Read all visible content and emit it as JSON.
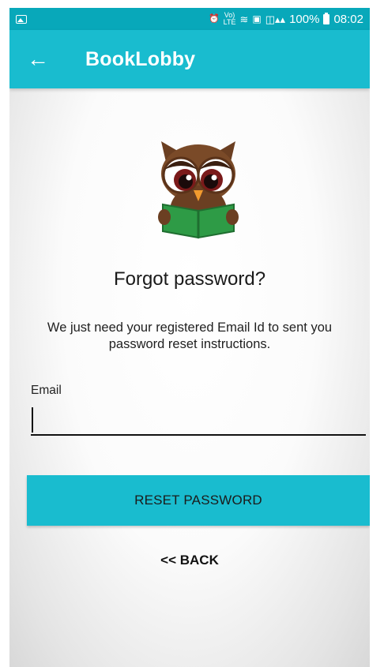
{
  "status_bar": {
    "volte_label": "Vo)\nLTE",
    "battery_percent": "100%",
    "time": "08:02"
  },
  "app_bar": {
    "title": "BookLobby",
    "back_icon": "arrow-left-icon"
  },
  "logo": {
    "icon": "owl-reading-book-icon"
  },
  "form": {
    "heading": "Forgot password?",
    "description": "We just need your registered Email Id to sent you password reset instructions.",
    "email_label": "Email",
    "email_value": "",
    "email_placeholder": "",
    "reset_button_label": "RESET PASSWORD",
    "back_link_label": "<< BACK"
  },
  "colors": {
    "status_bar": "#08a8ba",
    "primary": "#19bccf",
    "book_green": "#2e9b46",
    "owl_brown": "#6b3f22"
  }
}
